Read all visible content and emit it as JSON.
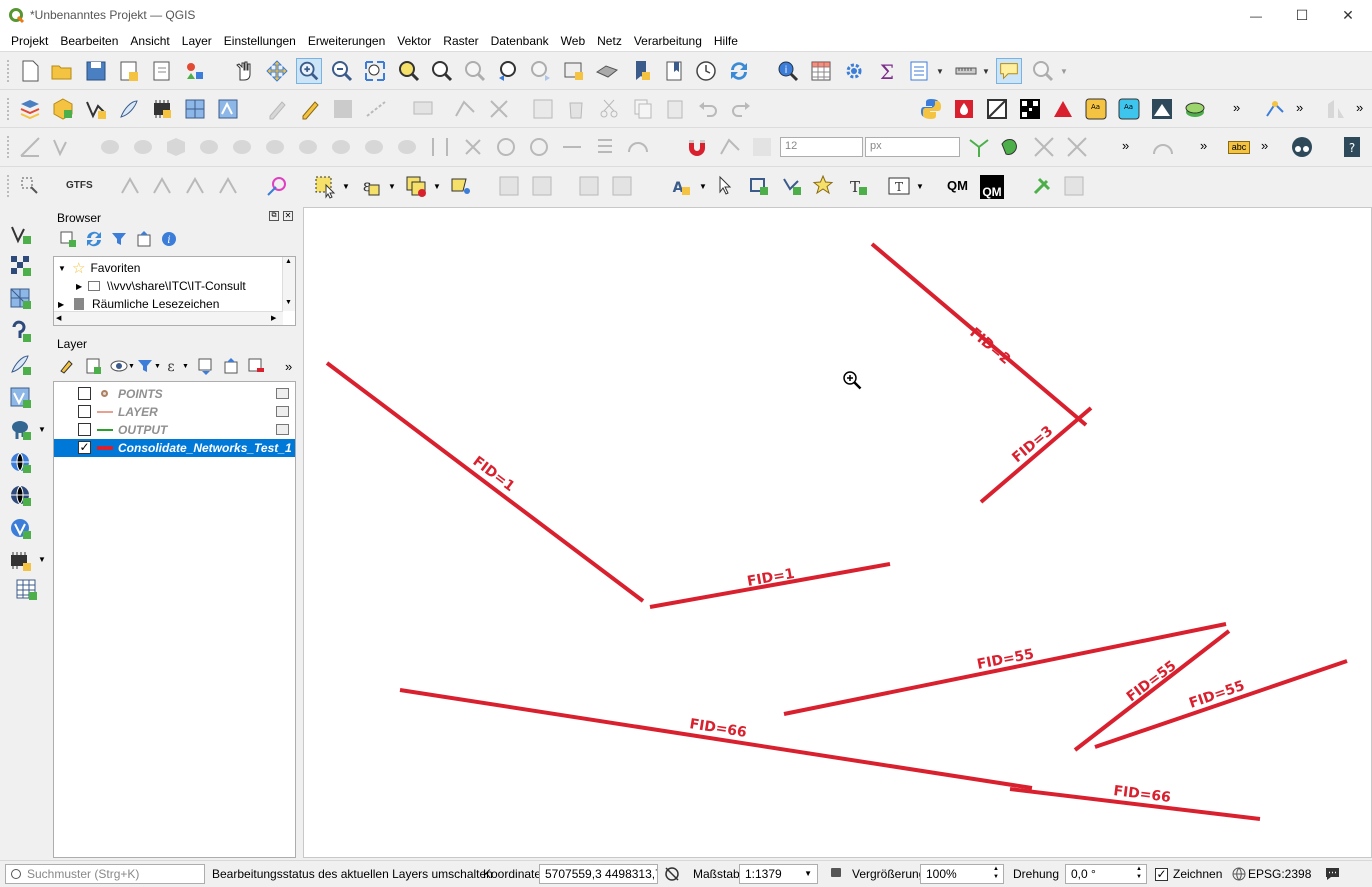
{
  "window": {
    "title": "*Unbenanntes Projekt — QGIS",
    "minimize_glyph": "—",
    "maximize_glyph": "☐",
    "close_glyph": "✕"
  },
  "menu": [
    "Projekt",
    "Bearbeiten",
    "Ansicht",
    "Layer",
    "Einstellungen",
    "Erweiterungen",
    "Vektor",
    "Raster",
    "Datenbank",
    "Web",
    "Netz",
    "Verarbeitung",
    "Hilfe"
  ],
  "toolbar": {
    "gtfs_label": "GTFS",
    "qm_label": "QM",
    "qm2_label": "QM",
    "abc_label": "abc",
    "more_glyph": "»",
    "snap_tolerance": "12",
    "snap_unit": "px"
  },
  "browser": {
    "title": "Browser",
    "items": [
      {
        "label": "Favoriten",
        "expanded": true
      },
      {
        "label": "\\\\vvv\\share\\ITC\\IT-Consult",
        "expanded": false
      },
      {
        "label": "Räumliche Lesezeichen",
        "expanded": false
      }
    ]
  },
  "layers": {
    "title": "Layer",
    "items": [
      {
        "label": "POINTS",
        "checked": false,
        "symbol": "point",
        "color": "#b08060"
      },
      {
        "label": "LAYER",
        "checked": false,
        "symbol": "line",
        "color": "#e8a090"
      },
      {
        "label": "OUTPUT",
        "checked": false,
        "symbol": "line",
        "color": "#2ca02c"
      },
      {
        "label": "Consolidate_Networks_Test_1",
        "checked": true,
        "symbol": "line",
        "color": "#d9202e",
        "selected": true
      }
    ]
  },
  "map": {
    "line_color": "#d9202e",
    "labels": [
      "FID=2",
      "FID=3",
      "FID=1",
      "FID=1",
      "FID=55",
      "FID=55",
      "FID=55",
      "FID=66",
      "FID=66"
    ]
  },
  "status": {
    "search_placeholder": "Suchmuster (Strg+K)",
    "message": "Bearbeitungsstatus des aktuellen Layers umschalten",
    "coord_label": "Koordinate",
    "coord_value": "5707559,3 4498313,7",
    "scale_label": "Maßstab",
    "scale_value": "1:1379",
    "magnifier_label": "Vergrößerung",
    "magnifier_value": "100%",
    "rotation_label": "Drehung",
    "rotation_value": "0,0 °",
    "render_label": "Zeichnen",
    "crs": "EPSG:2398"
  }
}
